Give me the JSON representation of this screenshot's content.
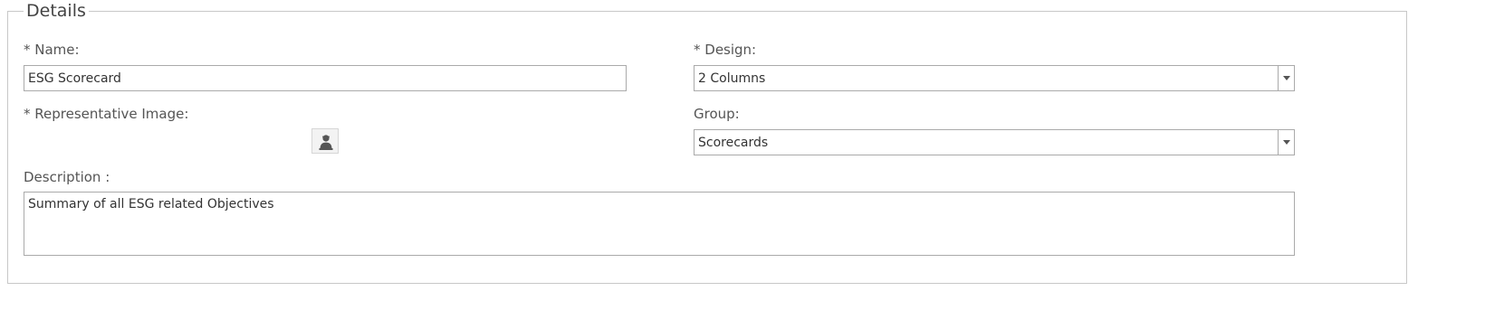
{
  "section": {
    "legend": "Details"
  },
  "name": {
    "label": "* Name:",
    "value": "ESG Scorecard"
  },
  "design": {
    "label": "* Design:",
    "value": "2 Columns"
  },
  "representative_image": {
    "label": "* Representative Image:",
    "icon": "person-icon"
  },
  "group": {
    "label": "Group:",
    "value": "Scorecards"
  },
  "description": {
    "label": "Description :",
    "value": "Summary of all ESG related Objectives"
  }
}
